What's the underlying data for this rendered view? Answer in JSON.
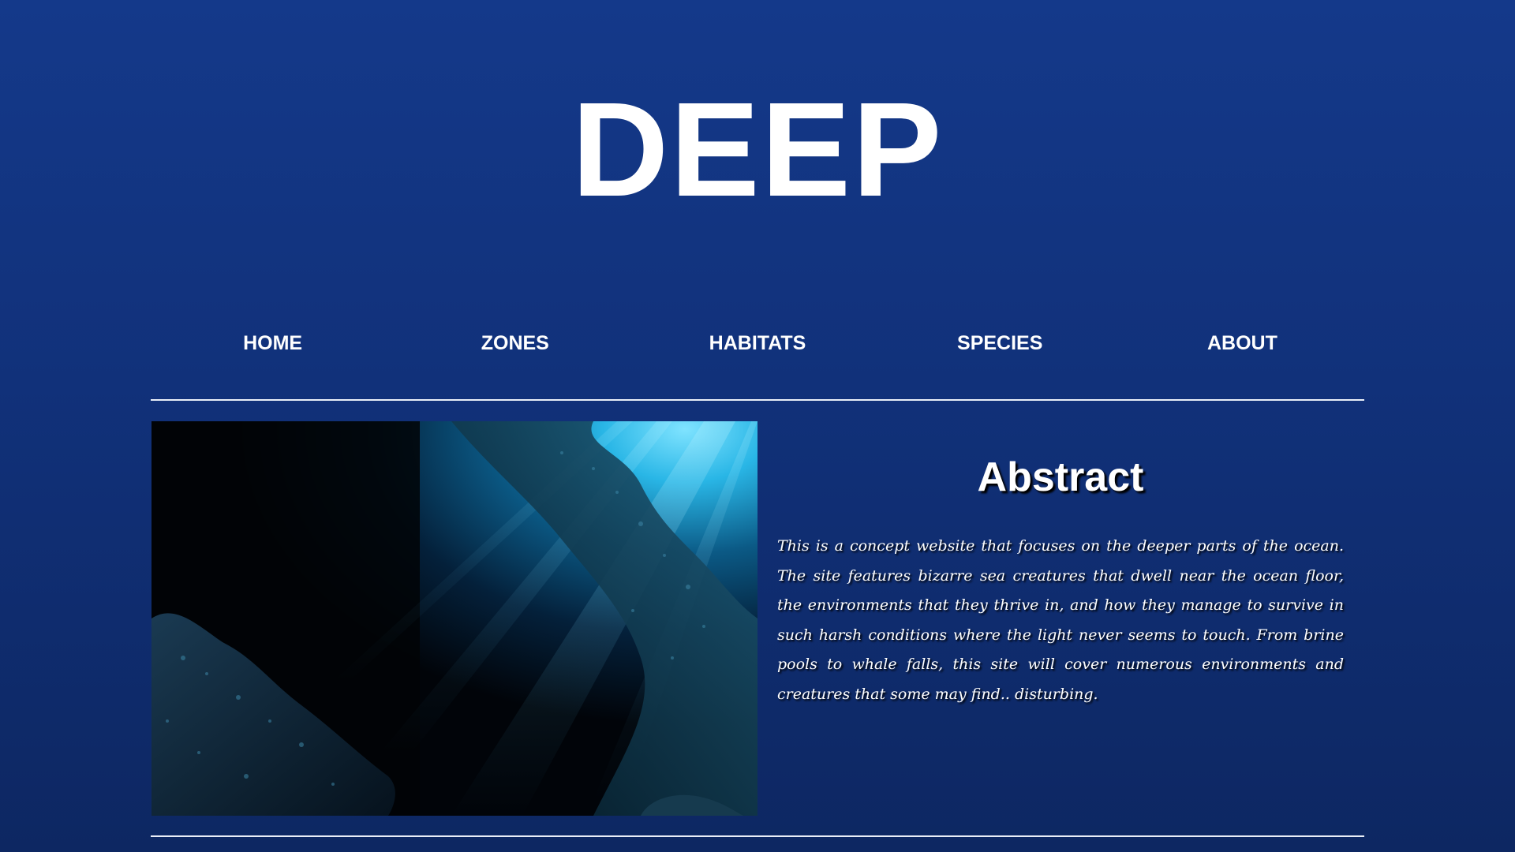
{
  "header": {
    "site_title": "DEEP"
  },
  "nav": {
    "items": [
      {
        "label": "HOME"
      },
      {
        "label": "ZONES"
      },
      {
        "label": "HABITATS"
      },
      {
        "label": "SPECIES"
      },
      {
        "label": "ABOUT"
      }
    ]
  },
  "hero": {
    "image_name": "underwater-cave-light-rays-photo"
  },
  "abstract": {
    "heading": "Abstract",
    "body": "This is a concept website that focuses on the deeper parts of the ocean. The site features bizarre sea creatures that dwell near the ocean floor, the environments that they thrive in, and how they manage to survive in such harsh conditions where the light never seems to touch. From brine pools to whale falls, this site will cover numerous environments and creatures that some may find.. disturbing."
  },
  "colors": {
    "background_top": "#14398a",
    "background_bottom": "#0d2762",
    "text": "#ffffff",
    "rule": "#e9eef8"
  }
}
